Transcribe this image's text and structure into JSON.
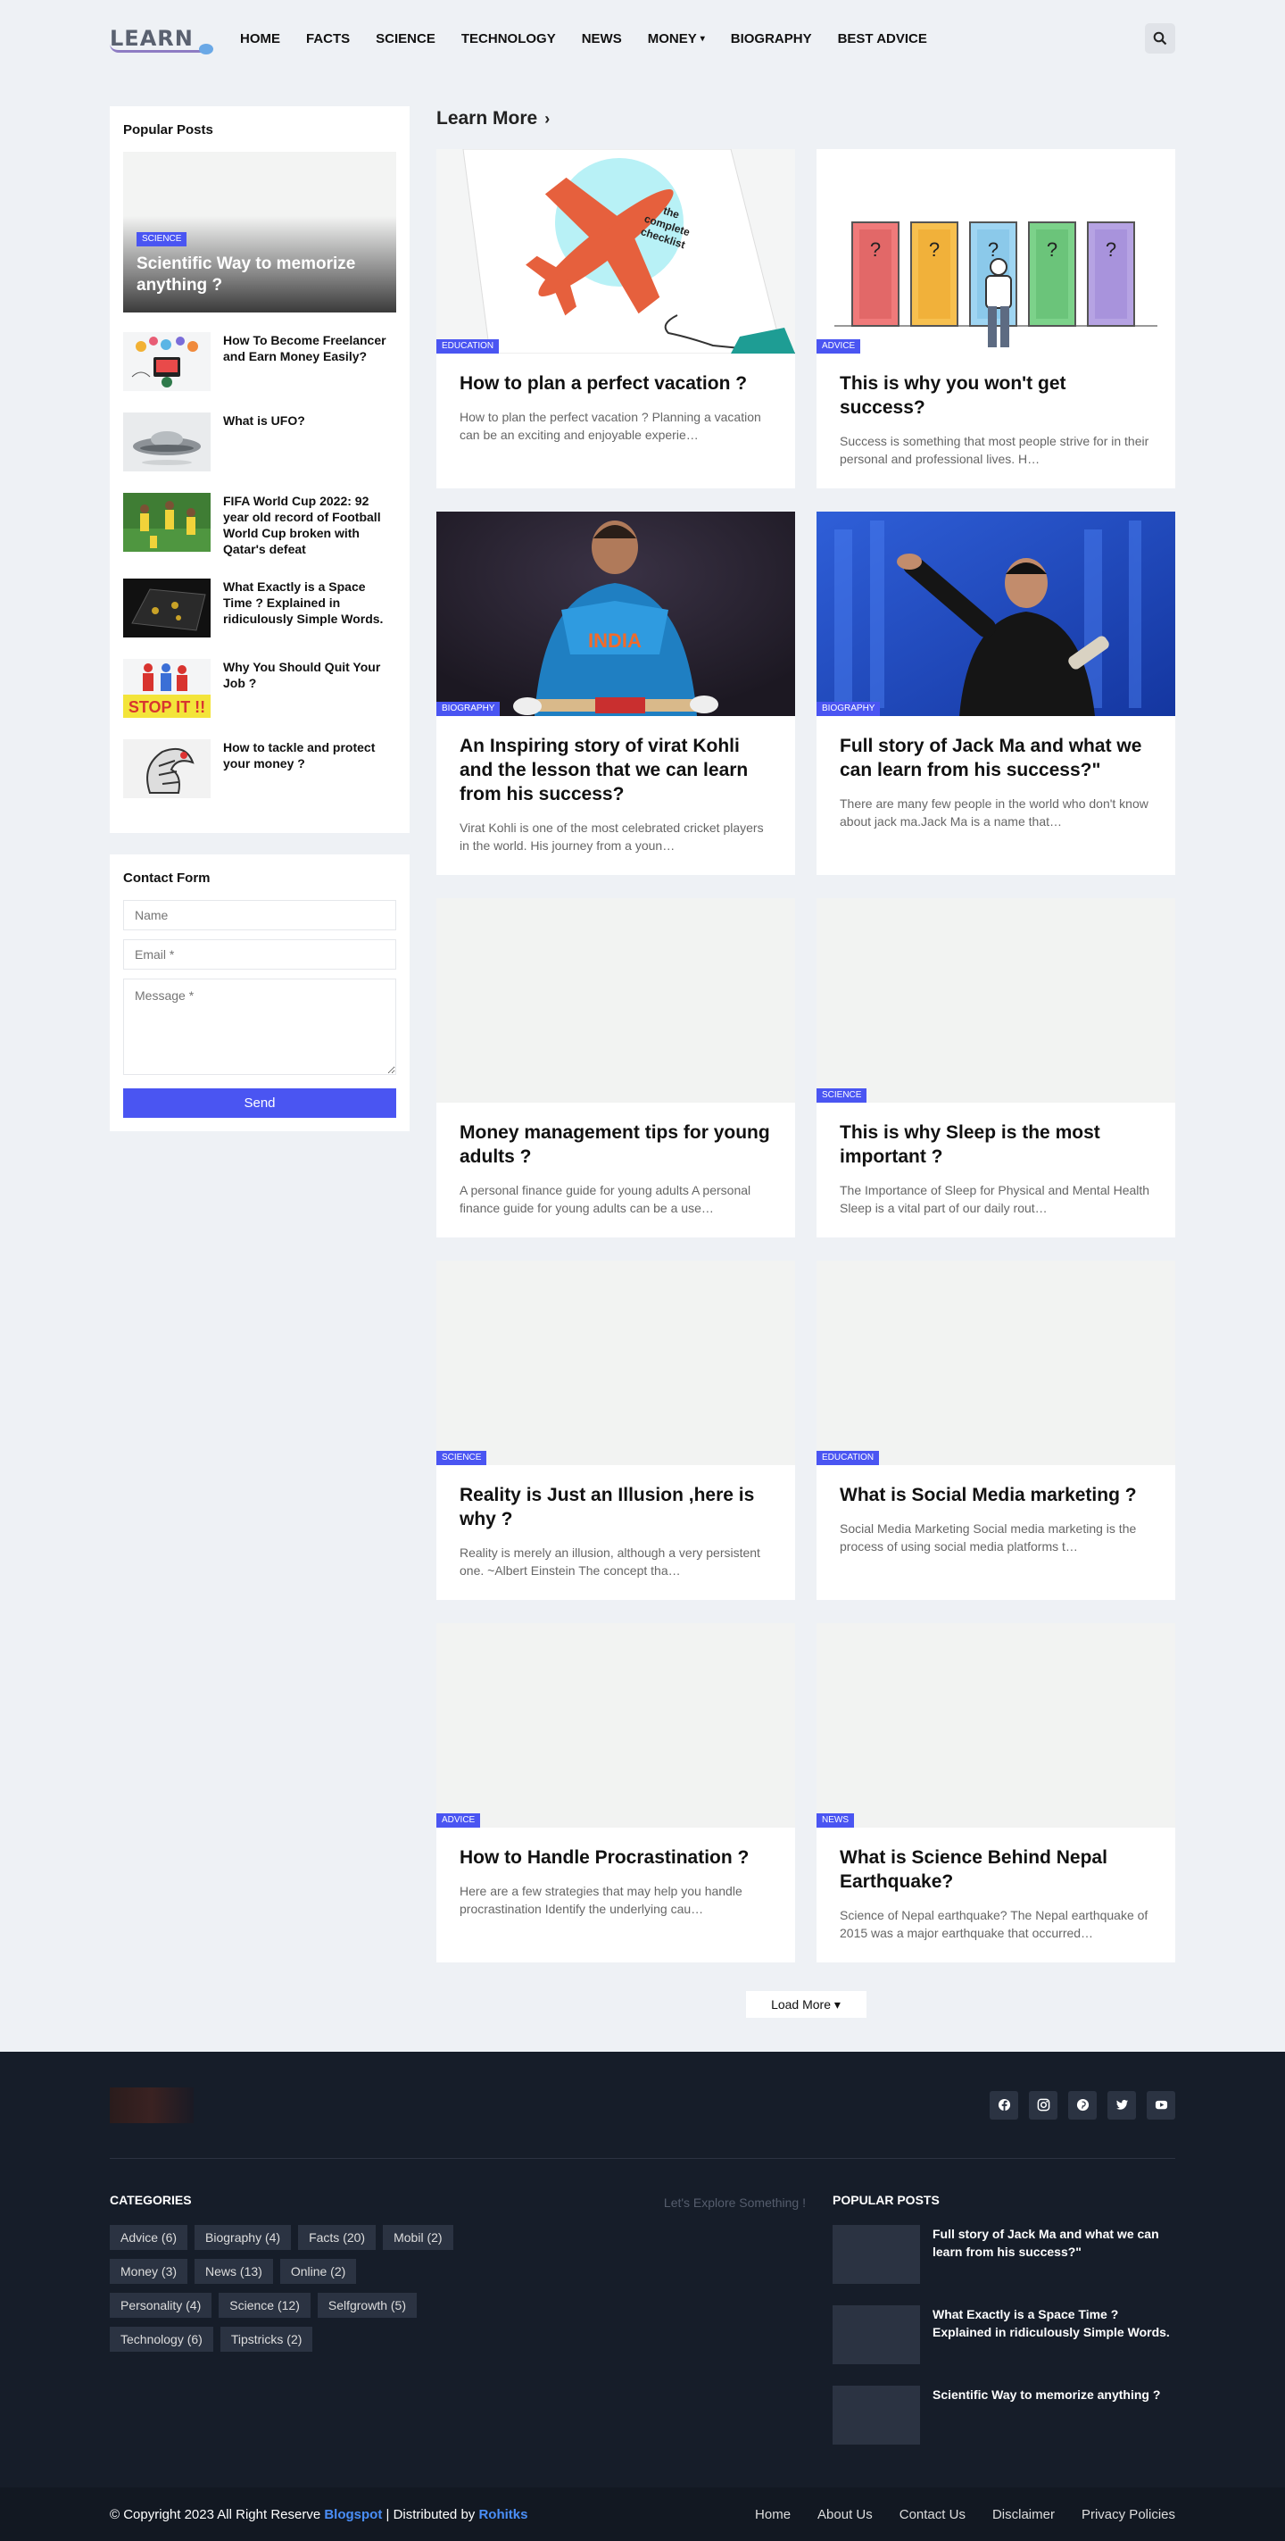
{
  "header": {
    "logo_text": "LEARN",
    "nav": [
      "HOME",
      "FACTS",
      "SCIENCE",
      "TECHNOLOGY",
      "NEWS",
      "MONEY",
      "BIOGRAPHY",
      "BEST ADVICE"
    ]
  },
  "sidebar": {
    "popular_title": "Popular Posts",
    "featured": {
      "tag": "SCIENCE",
      "title": "Scientific Way to memorize anything ?"
    },
    "items": [
      "How To Become Freelancer and Earn Money Easily?",
      "What is UFO?",
      "FIFA World Cup 2022: 92 year old record of Football World Cup broken with Qatar's defeat",
      "What Exactly is a Space Time ? Explained in ridiculously Simple Words.",
      "Why You Should Quit Your Job ?",
      "How to tackle and protect your money ?"
    ],
    "contact": {
      "title": "Contact Form",
      "name_ph": "Name",
      "email_ph": "Email *",
      "message_ph": "Message *",
      "send": "Send"
    }
  },
  "main": {
    "section_title": "Learn More",
    "cards": [
      {
        "tag": "EDUCATION",
        "title": "How to plan a perfect vacation ?",
        "excerpt": "How to plan the perfect vacation ? Planning a vacation can be an exciting and enjoyable experie…",
        "image_text": "the complete checklist"
      },
      {
        "tag": "ADVICE",
        "title": "This is why you won't get success?",
        "excerpt": "Success is something that most people strive for in their personal and professional lives. H…"
      },
      {
        "tag": "BIOGRAPHY",
        "title": "An Inspiring story of virat Kohli and the lesson that we can learn from his success?",
        "excerpt": "Virat Kohli is one of the most celebrated cricket players in the world. His journey from a youn…",
        "image_text": "INDIA"
      },
      {
        "tag": "BIOGRAPHY",
        "title": "Full story of Jack Ma and what we can learn from his success?\"",
        "excerpt": "There are many few people in the world who don't know about jack ma.Jack Ma is a name that…"
      },
      {
        "tag": "",
        "title": "Money management tips for young adults ?",
        "excerpt": "A personal finance guide for young adults A personal finance guide for young adults can be a use…"
      },
      {
        "tag": "SCIENCE",
        "title": "This is why Sleep is the most important ?",
        "excerpt": "The Importance of Sleep for Physical and Mental Health Sleep is a vital part of our daily rout…"
      },
      {
        "tag": "SCIENCE",
        "title": "Reality is Just an Illusion ,here is why ?",
        "excerpt": "Reality is merely an illusion, although a very persistent one. ~Albert Einstein  The concept tha…"
      },
      {
        "tag": "EDUCATION",
        "title": "What is Social Media marketing ?",
        "excerpt": "Social Media Marketing Social media marketing is the process of using social media platforms t…"
      },
      {
        "tag": "ADVICE",
        "title": "How to Handle Procrastination ?",
        "excerpt": "Here are a few strategies that may help you handle procrastination Identify the underlying cau…"
      },
      {
        "tag": "NEWS",
        "title": "What is Science Behind Nepal Earthquake?",
        "excerpt": "Science of Nepal earthquake? The Nepal earthquake of 2015 was a major earthquake that occurred…"
      }
    ],
    "load_more": "Load More"
  },
  "footer": {
    "categories_title": "CATEGORIES",
    "explore_text": "Let's Explore Something !",
    "categories": [
      "Advice (6)",
      "Biography (4)",
      "Facts (20)",
      "Mobil (2)",
      "Money (3)",
      "News (13)",
      "Online (2)",
      "Personality (4)",
      "Science (12)",
      "Selfgrowth (5)",
      "Technology (6)",
      "Tipstricks (2)"
    ],
    "popular_title": "POPULAR POSTS",
    "popular": [
      "Full story of Jack Ma and what we can learn from his success?\"",
      "What Exactly is a Space Time ? Explained in ridiculously Simple Words.",
      "Scientific Way to memorize anything ?"
    ],
    "copyright_prefix": "© Copyright 2023 All Right Reserve ",
    "copyright_link": "Blogspot",
    "distributed_prefix": " | Distributed by ",
    "distributed_link": "Rohitks",
    "links": [
      "Home",
      "About Us",
      "Contact Us",
      "Disclaimer",
      "Privacy Policies"
    ]
  },
  "colors": {
    "accent": "#4a55f2",
    "page_bg": "#eef1f5",
    "footer_bg": "#161d29"
  }
}
